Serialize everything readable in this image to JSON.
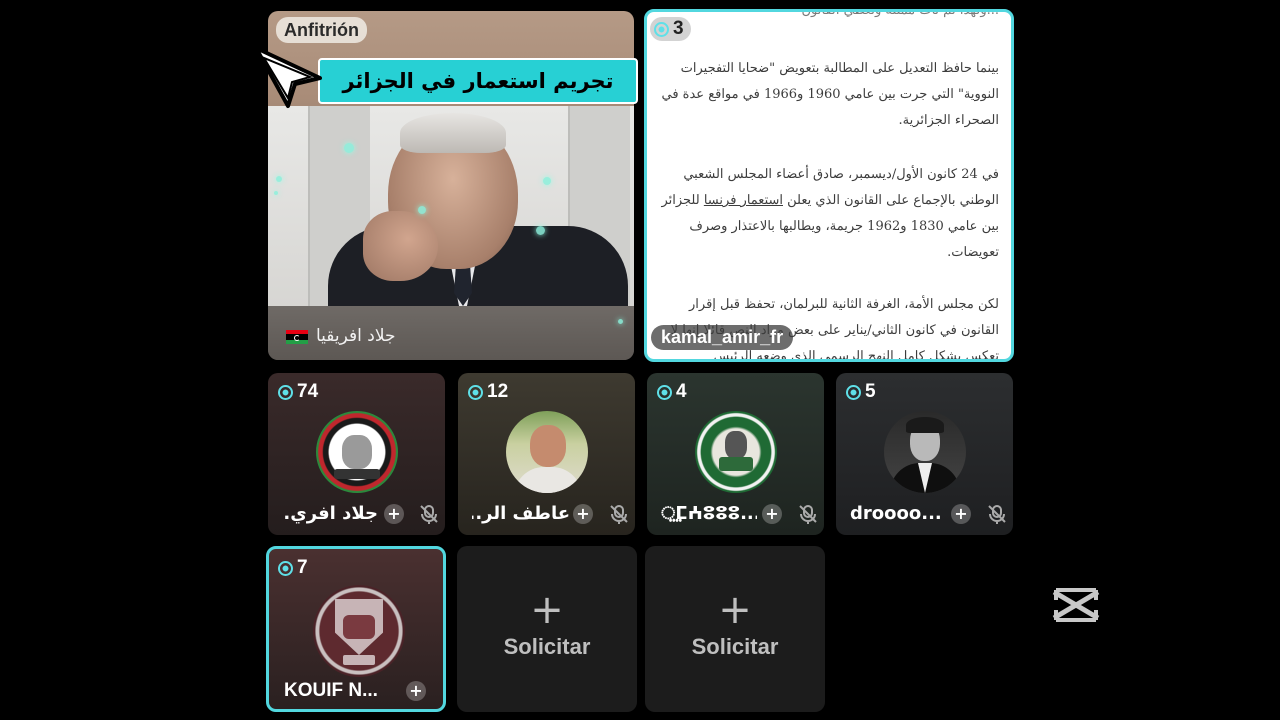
{
  "host_tile": {
    "badge": "Anfitrión",
    "headline": "تجريم استعمار في الجزائر",
    "name": "جلاد افريقيا"
  },
  "article_tile": {
    "viewers": "3",
    "paragraph_0": "...ولهذا لم تأت ممثلة وتعطي القانون",
    "paragraph_1": "بينما حافظ التعديل على المطالبة بتعويض \"ضحايا التفجيرات النووية\" التي جرت بين عامي 1960 و1966 في مواقع عدة في الصحراء الجزائرية.",
    "paragraph_2_before": "في 24 كانون الأول/ديسمبر، صادق أعضاء المجلس الشعبي الوطني بالإجماع على القانون الذي يعلن ",
    "paragraph_2_link": "استعمار فرنسا",
    "paragraph_2_after": " للجزائر بين عامي 1830 و1962 جريمة، ويطالبها بالاعتذار وصرف تعويضات.",
    "paragraph_3": "لكن مجلس الأمة، الغرفة الثانية للبرلمان، تحفظ قبل إقرار القانون في كانون الثاني/يناير على بعض مواد النص قائلا إنها لا تعكس بشكل كامل النهج الرسمي الذي وضعه الرئيس",
    "username": "kamal_amir_fr"
  },
  "participants": [
    {
      "viewers": "74",
      "name": "جلاد افري...",
      "avatar": "groupe-libya-omar-al-mukhtar-logo"
    },
    {
      "viewers": "12",
      "name": "عاطف الر...",
      "avatar": "man-photo"
    },
    {
      "viewers": "4",
      "name": "⵿ⵎⵄⵓⵓⵓ...",
      "avatar": "green-emblem"
    },
    {
      "viewers": "5",
      "name": "droooo...",
      "avatar": "man-in-suit-photo"
    }
  ],
  "bottom_row": {
    "active": {
      "viewers": "7",
      "name": "KOUIF N...",
      "avatar": "club-crest-1912"
    },
    "slots": [
      {
        "plus": "+",
        "label": "Solicitar"
      },
      {
        "plus": "+",
        "label": "Solicitar"
      }
    ]
  },
  "colors": {
    "accent": "#52d7df",
    "headline_bg": "#27d0d4",
    "background": "#000000"
  }
}
